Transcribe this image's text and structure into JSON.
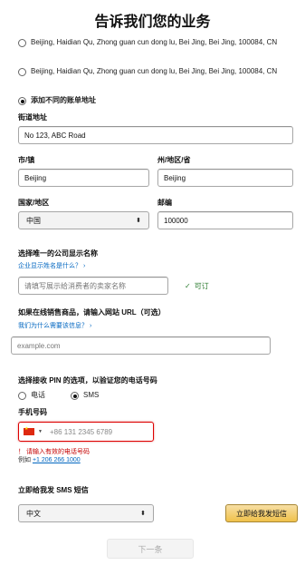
{
  "page_title": "告诉我们您的业务",
  "address_options": [
    {
      "label": "Beijing, Haidian Qu, Zhong guan cun dong lu, Bei Jing, Bei Jing, 100084, CN",
      "checked": false
    },
    {
      "label": "Beijing, Haidian Qu, Zhong guan cun dong lu, Bei Jing, Bei Jing, 100084, CN",
      "checked": false
    },
    {
      "label": "添加不同的账单地址",
      "checked": true
    }
  ],
  "street": {
    "label": "街道地址",
    "value": "No 123, ABC Road"
  },
  "city": {
    "label": "市/镇",
    "value": "Beijing"
  },
  "state": {
    "label": "州/地区/省",
    "value": "Beijing"
  },
  "country": {
    "label": "国家/地区",
    "value": "中国"
  },
  "postal": {
    "label": "邮编",
    "value": "100000"
  },
  "company": {
    "label": "选择唯一的公司显示名称",
    "help_link": "企业显示姓名是什么？ ›",
    "placeholder": "请填写展示给消费者的卖家名称",
    "status": "可订"
  },
  "website": {
    "label": "如果在线销售商品，请输入网站 URL（可选）",
    "help_link": "我们为什么需要该信息？ ›",
    "placeholder": "example.com"
  },
  "pin": {
    "label": "选择接收 PIN 的选项，以验证您的电话号码",
    "options": [
      {
        "label": "电话",
        "checked": false
      },
      {
        "label": "SMS",
        "checked": true
      }
    ]
  },
  "phone": {
    "label": "手机号码",
    "placeholder": "+86 131 2345 6789",
    "error": "！ 请输入有效的电话号码",
    "example_prefix": "例如 ",
    "example_number": "+1 206 266 1000"
  },
  "sms": {
    "label": "立即给我发 SMS 短信",
    "language": "中文",
    "send_button": "立即给我发短信"
  },
  "next_button": "下一条"
}
